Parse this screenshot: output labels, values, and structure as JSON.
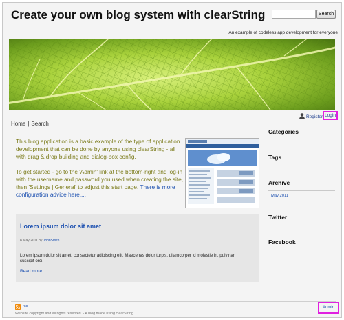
{
  "header": {
    "title": "Create your own blog system with clearString",
    "tagline": "An example of codeless app development for everyone"
  },
  "search": {
    "placeholder": "",
    "button_label": "Search"
  },
  "account": {
    "register_label": "Register",
    "login_label": "Login"
  },
  "nav": {
    "items": [
      "Home",
      "Search"
    ],
    "separator": "|"
  },
  "intro": {
    "paragraph1": "This blog application is a basic example of the type of application development that can be done by anyone using clearString - all with drag & drop building and dialog-box config.",
    "paragraph2": "To get started -  go to the 'Admin' link at the bottom-right and log-in with the username and password you used when creating the site, then 'Settings | General' to adjust this start page.",
    "more_link": "There is more configuration advice here...."
  },
  "post": {
    "title": "Lorem ipsum dolor sit amet",
    "date": "8 May 2011",
    "by": "by",
    "author": "JohnSmith",
    "excerpt": "Lorem ipsum dolor sit amet, consectetur adipiscing elit. Maecenas dolor turpis, ullamcorper id molestie in, pulvinar suscipit orci.",
    "read_more": "Read more..."
  },
  "sidebar": {
    "categories": "Categories",
    "tags": "Tags",
    "archive": "Archive",
    "archive_items": [
      "May 2011"
    ],
    "twitter": "Twitter",
    "facebook": "Facebook"
  },
  "footer": {
    "rss_label": "rss",
    "copyright": "Website copyright and all rights reserved.  - A blog made using clearString.",
    "admin_label": "Admin"
  },
  "colors": {
    "link": "#1c50b0",
    "intro_text": "#7c7c1c",
    "highlight_border": "#e020e0",
    "post_box_bg": "#e6e6e6"
  },
  "icons": {
    "user": "user-icon",
    "rss": "rss-icon"
  }
}
